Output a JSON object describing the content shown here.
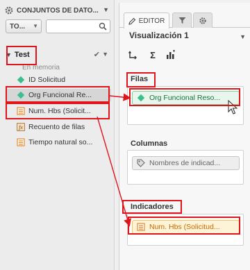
{
  "datasets": {
    "title": "CONJUNTOS DE DATO...",
    "type_value": "TO...",
    "search_placeholder": ""
  },
  "tree": {
    "root": "Test",
    "sub_label": "En memoria",
    "fields": [
      {
        "label": "ID Solicitud",
        "icon": "dimension-icon"
      },
      {
        "label": "Org Funcional Re...",
        "icon": "dimension-icon"
      },
      {
        "label": "Num. Hbs (Solicit...",
        "icon": "measure-icon"
      },
      {
        "label": "Recuento de filas",
        "icon": "function-icon"
      },
      {
        "label": "Tiempo natural so...",
        "icon": "measure-icon"
      }
    ]
  },
  "editor": {
    "tabs": {
      "editor": "EDITOR"
    },
    "viz_title": "Visualización 1",
    "tools": [
      "pivot",
      "Σ",
      "chart"
    ],
    "sections": {
      "filas": {
        "label": "Filas",
        "chip": "Org Funcional Reso..."
      },
      "columnas": {
        "label": "Columnas",
        "chip": "Nombres de indicad..."
      },
      "indicadores": {
        "label": "Indicadores",
        "chip": "Num. Hbs (Solicitud..."
      }
    }
  },
  "colors": {
    "annotation": "#e0141b",
    "dimension": "#3bbf8e",
    "measure": "#e8892b"
  }
}
